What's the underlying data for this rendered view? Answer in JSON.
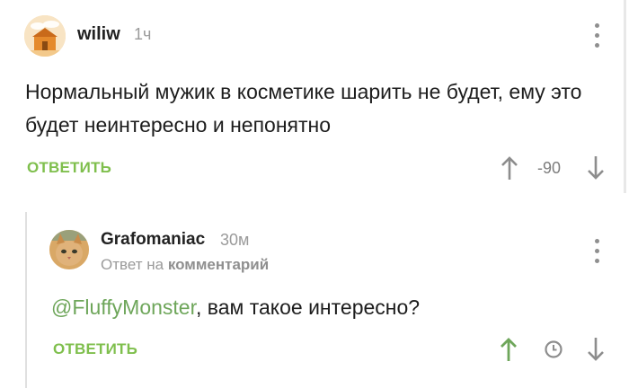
{
  "comments": [
    {
      "username": "wiliw",
      "time": "1ч",
      "text": "Нормальный мужик в косметике шарить не будет, ему это будет неинтересно и непонятно",
      "reply_label": "ОТВЕТИТЬ",
      "score": "-90",
      "icons": [
        "avatar-house-icon",
        "up-arrow-icon",
        "down-arrow-icon",
        "more-vertical-icon"
      ]
    },
    {
      "username": "Grafomaniac",
      "time": "30м",
      "reply_to_prefix": "Ответ на",
      "reply_to_target": "комментарий",
      "mention": "@FluffyMonster",
      "text_rest": ", вам такое интересно?",
      "reply_label": "ОТВЕТИТЬ",
      "icons": [
        "avatar-cat-icon",
        "up-arrow-icon",
        "clock-icon",
        "down-arrow-icon",
        "more-vertical-icon"
      ]
    }
  ],
  "colors": {
    "accent_green": "#7fbf4d",
    "upvoted_green": "#6ea65a",
    "muted_gray": "#9a9a9a"
  }
}
